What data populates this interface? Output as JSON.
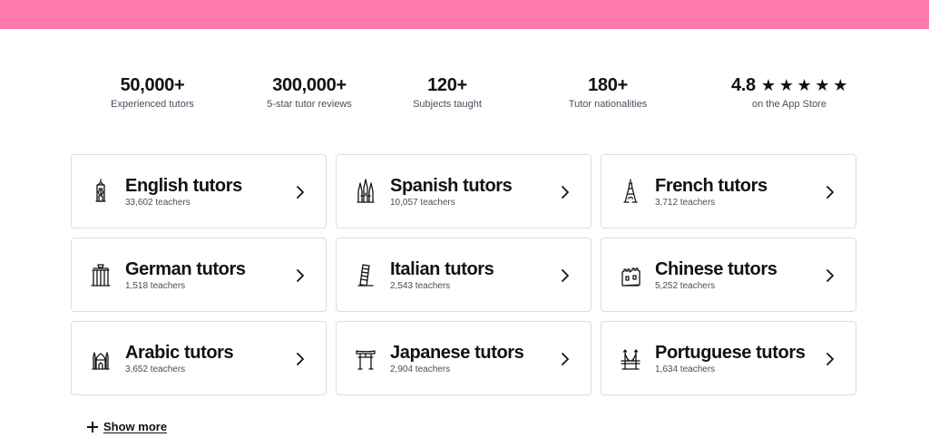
{
  "colors": {
    "top_band": "#ff7aac",
    "text": "#121117",
    "muted": "#4d4c5c",
    "border": "#dcdce5"
  },
  "stats": [
    {
      "value": "50,000+",
      "label": "Experienced tutors"
    },
    {
      "value": "300,000+",
      "label": "5-star tutor reviews"
    },
    {
      "value": "120+",
      "label": "Subjects taught"
    },
    {
      "value": "180+",
      "label": "Tutor nationalities"
    },
    {
      "value": "4.8",
      "label": "on the App Store",
      "stars": 5
    }
  ],
  "categories": [
    {
      "title": "English tutors",
      "count": "33,602 teachers",
      "icon": "big-ben-icon"
    },
    {
      "title": "Spanish tutors",
      "count": "10,057 teachers",
      "icon": "sagrada-familia-icon"
    },
    {
      "title": "French tutors",
      "count": "3,712 teachers",
      "icon": "eiffel-tower-icon"
    },
    {
      "title": "German tutors",
      "count": "1,518 teachers",
      "icon": "brandenburg-gate-icon"
    },
    {
      "title": "Italian tutors",
      "count": "2,543 teachers",
      "icon": "leaning-tower-icon"
    },
    {
      "title": "Chinese tutors",
      "count": "5,252 teachers",
      "icon": "great-wall-icon"
    },
    {
      "title": "Arabic tutors",
      "count": "3,652 teachers",
      "icon": "mosque-icon"
    },
    {
      "title": "Japanese tutors",
      "count": "2,904 teachers",
      "icon": "torii-gate-icon"
    },
    {
      "title": "Portuguese tutors",
      "count": "1,634 teachers",
      "icon": "bridge-icon"
    }
  ],
  "show_more": {
    "label": "Show more",
    "icon": "plus-icon"
  }
}
